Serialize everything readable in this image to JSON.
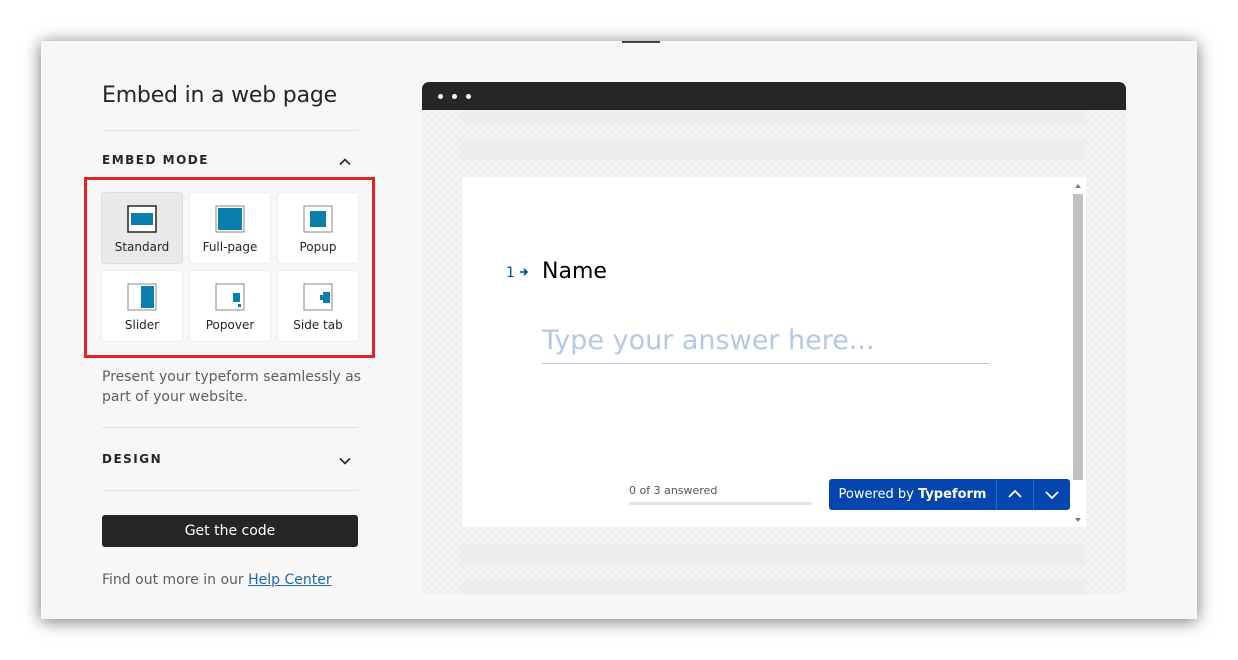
{
  "panel": {
    "title": "Embed in a web page",
    "embed_mode_label": "EMBED MODE",
    "design_label": "DESIGN",
    "description": "Present your typeform seamlessly as part of your website.",
    "get_code_label": "Get the code",
    "help_prefix": "Find out more in our ",
    "help_link": "Help Center"
  },
  "modes": [
    {
      "label": "Standard",
      "selected": true
    },
    {
      "label": "Full-page",
      "selected": false
    },
    {
      "label": "Popup",
      "selected": false
    },
    {
      "label": "Slider",
      "selected": false
    },
    {
      "label": "Popover",
      "selected": false
    },
    {
      "label": "Side tab",
      "selected": false
    }
  ],
  "preview": {
    "question_number": "1",
    "question_text": "Name",
    "answer_placeholder": "Type your answer here...",
    "answer_value": "",
    "progress_text": "0 of 3 answered",
    "progress_fraction": 0,
    "powered_prefix": "Powered by ",
    "powered_brand": "Typeform"
  },
  "colors": {
    "accent": "#0445af",
    "dark": "#262626",
    "highlight": "#e52222",
    "placeholder": "#b4c7e7"
  }
}
